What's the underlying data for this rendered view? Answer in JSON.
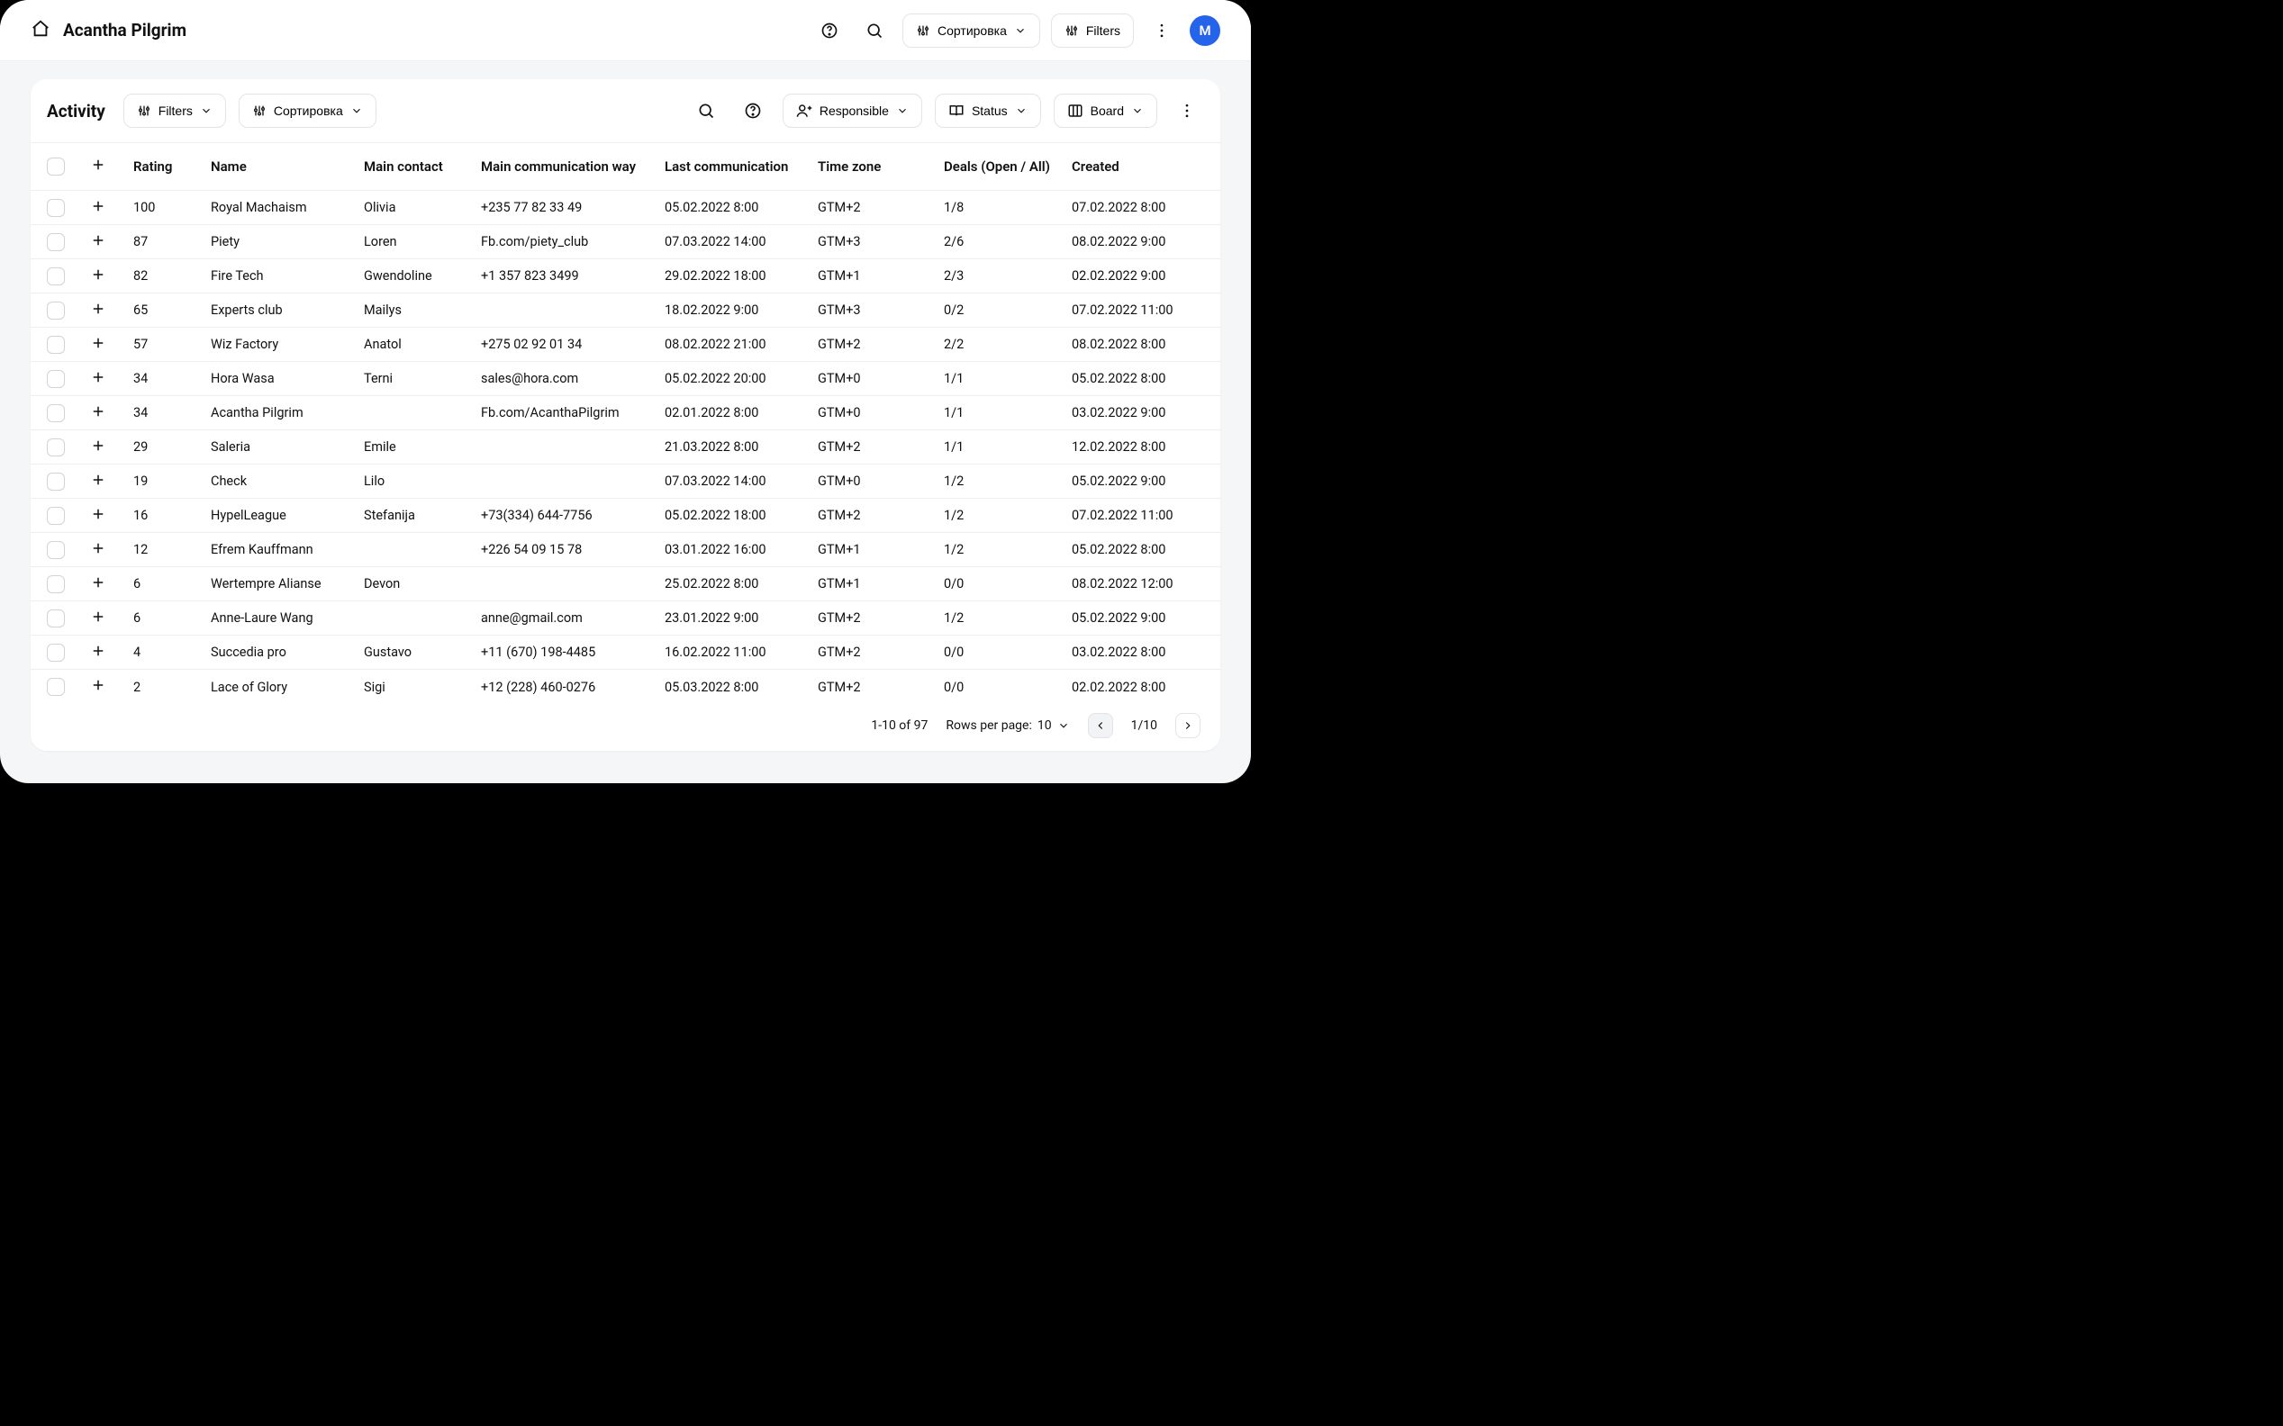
{
  "header": {
    "title": "Acantha Pilgrim",
    "sort_label": "Сортировка",
    "filters_label": "Filters",
    "avatar_letter": "M"
  },
  "panel": {
    "title": "Activity",
    "filters_label": "Filters",
    "sort_label": "Сортировка",
    "responsible_label": "Responsible",
    "status_label": "Status",
    "board_label": "Board"
  },
  "columns": {
    "rating": "Rating",
    "name": "Name",
    "main_contact": "Main contact",
    "main_comm": "Main communication way",
    "last_comm": "Last communication",
    "tz": "Time zone",
    "deals": "Deals (Open / All)",
    "created": "Created"
  },
  "rows": [
    {
      "rating": "100",
      "name": "Royal Machaism",
      "contact": "Olivia",
      "comm": "+235 77 82 33 49",
      "last": "05.02.2022 8:00",
      "tz": "GTM+2",
      "deals": "1/8",
      "created": "07.02.2022 8:00"
    },
    {
      "rating": "87",
      "name": "Piety",
      "contact": "Loren",
      "comm": "Fb.com/piety_club",
      "last": "07.03.2022 14:00",
      "tz": "GTM+3",
      "deals": "2/6",
      "created": "08.02.2022 9:00"
    },
    {
      "rating": "82",
      "name": "Fire Tech",
      "contact": "Gwendoline",
      "comm": "+1 357 823 3499",
      "last": "29.02.2022 18:00",
      "tz": "GTM+1",
      "deals": "2/3",
      "created": "02.02.2022 9:00"
    },
    {
      "rating": "65",
      "name": "Experts club",
      "contact": "Mailys",
      "comm": "",
      "last": "18.02.2022 9:00",
      "tz": "GTM+3",
      "deals": "0/2",
      "created": "07.02.2022 11:00"
    },
    {
      "rating": "57",
      "name": "Wiz Factory",
      "contact": "Anatol",
      "comm": "+275 02 92 01 34",
      "last": "08.02.2022 21:00",
      "tz": "GTM+2",
      "deals": "2/2",
      "created": "08.02.2022 8:00"
    },
    {
      "rating": "34",
      "name": "Hora Wasa",
      "contact": "Terni",
      "comm": "sales@hora.com",
      "last": "05.02.2022 20:00",
      "tz": "GTM+0",
      "deals": "1/1",
      "created": "05.02.2022 8:00"
    },
    {
      "rating": "34",
      "name": "Acantha Pilgrim",
      "contact": "",
      "comm": "Fb.com/AcanthaPilgrim",
      "last": "02.01.2022 8:00",
      "tz": "GTM+0",
      "deals": "1/1",
      "created": "03.02.2022 9:00"
    },
    {
      "rating": "29",
      "name": "Saleria",
      "contact": "Emile",
      "comm": "",
      "last": "21.03.2022 8:00",
      "tz": "GTM+2",
      "deals": "1/1",
      "created": "12.02.2022 8:00"
    },
    {
      "rating": "19",
      "name": "Check",
      "contact": "Lilo",
      "comm": "",
      "last": "07.03.2022 14:00",
      "tz": "GTM+0",
      "deals": "1/2",
      "created": "05.02.2022 9:00"
    },
    {
      "rating": "16",
      "name": "HypelLeague",
      "contact": "Stefanija",
      "comm": "+73(334) 644-7756",
      "last": "05.02.2022 18:00",
      "tz": "GTM+2",
      "deals": "1/2",
      "created": "07.02.2022 11:00"
    },
    {
      "rating": "12",
      "name": "Efrem Kauffmann",
      "contact": "",
      "comm": "+226 54 09 15 78",
      "last": "03.01.2022 16:00",
      "tz": "GTM+1",
      "deals": "1/2",
      "created": "05.02.2022 8:00"
    },
    {
      "rating": "6",
      "name": "Wertempre Alianse",
      "contact": "Devon",
      "comm": "",
      "last": "25.02.2022 8:00",
      "tz": "GTM+1",
      "deals": "0/0",
      "created": "08.02.2022 12:00"
    },
    {
      "rating": "6",
      "name": "Anne-Laure Wang",
      "contact": "",
      "comm": "anne@gmail.com",
      "last": "23.01.2022 9:00",
      "tz": "GTM+2",
      "deals": "1/2",
      "created": "05.02.2022 9:00"
    },
    {
      "rating": "4",
      "name": "Succedia pro",
      "contact": "Gustavo",
      "comm": "+11 (670) 198-4485",
      "last": "16.02.2022 11:00",
      "tz": "GTM+2",
      "deals": "0/0",
      "created": "03.02.2022 8:00"
    },
    {
      "rating": "2",
      "name": "Lace of Glory",
      "contact": "Sigi",
      "comm": "+12 (228) 460-0276",
      "last": "05.03.2022 8:00",
      "tz": "GTM+2",
      "deals": "0/0",
      "created": "02.02.2022 8:00"
    }
  ],
  "pager": {
    "range": "1-10 of 97",
    "rpp_label": "Rows per page:",
    "rpp_value": "10",
    "page": "1/10"
  }
}
